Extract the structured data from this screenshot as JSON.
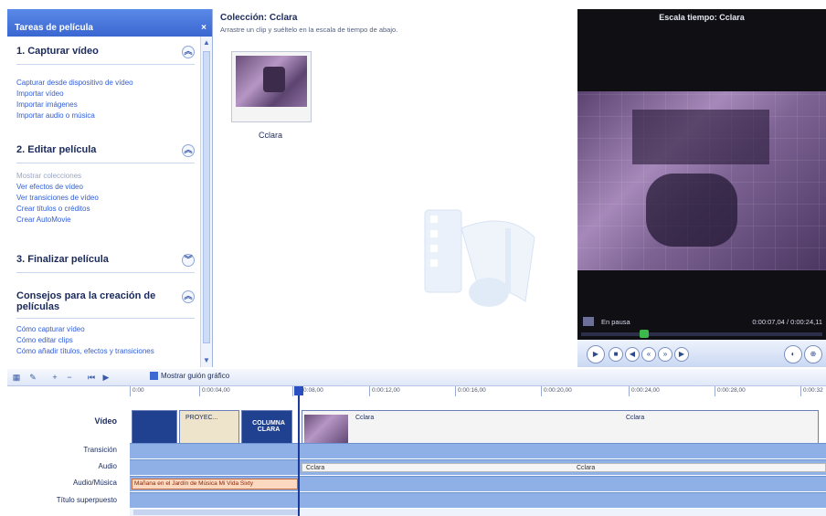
{
  "taskpane": {
    "header": "Tareas de película",
    "close_glyph": "×",
    "sections": [
      {
        "title": "1. Capturar vídeo",
        "links": [
          {
            "label": "Capturar desde dispositivo de vídeo",
            "muted": false
          },
          {
            "label": "Importar vídeo",
            "muted": false
          },
          {
            "label": "Importar imágenes",
            "muted": false
          },
          {
            "label": "Importar audio o música",
            "muted": false
          }
        ]
      },
      {
        "title": "2. Editar película",
        "links": [
          {
            "label": "Mostrar colecciones",
            "muted": true
          },
          {
            "label": "Ver efectos de vídeo",
            "muted": false
          },
          {
            "label": "Ver transiciones de vídeo",
            "muted": false
          },
          {
            "label": "Crear títulos o créditos",
            "muted": false
          },
          {
            "label": "Crear AutoMovie",
            "muted": false
          }
        ]
      },
      {
        "title": "3. Finalizar película",
        "links": []
      },
      {
        "title": "Consejos para la creación de películas",
        "links": [
          {
            "label": "Cómo capturar vídeo",
            "muted": false
          },
          {
            "label": "Cómo editar clips",
            "muted": false
          },
          {
            "label": "Cómo añadir títulos, efectos y transiciones",
            "muted": false
          }
        ]
      }
    ]
  },
  "collection": {
    "title": "Colección: Cclara",
    "subtitle": "Arrastre un clip y suéltelo en la escala de tiempo de abajo.",
    "clip_label": "Cclara"
  },
  "preview": {
    "title": "Escala tiempo: Cclara",
    "status_left": "En pausa",
    "status_right": "0:00:07,04 / 0:00:24,11",
    "seek_fraction": 0.25
  },
  "storyboard": {
    "show_storyboard": "Mostrar guión gráfico"
  },
  "timeline": {
    "tracks": [
      "Vídeo",
      "Transición",
      "Audio",
      "Audio/Música",
      "Título superpuesto"
    ],
    "ruler": [
      "0:00",
      "0:00:04,00",
      "0:00:08,00",
      "0:00:12,00",
      "0:00:16,00",
      "0:00:20,00",
      "0:00:24,00",
      "0:00:28,00",
      "0:00:32"
    ],
    "video_clips": [
      {
        "label": "",
        "kind": "title",
        "color": "#20418f"
      },
      {
        "label": "PROYEC...",
        "kind": "beige",
        "color": "#eee4cc"
      },
      {
        "label": "COLUMNA CLARA",
        "kind": "title",
        "color": "#20418f"
      },
      {
        "label": "Cclara",
        "kind": "video",
        "color": "#f4f4f4"
      }
    ],
    "video_clip_sub": "Cclara",
    "audio_labels": [
      "Cclara",
      "Cclara"
    ],
    "music_clip": "Mañana en el Jardín de Música Mi Vida Sixty"
  }
}
